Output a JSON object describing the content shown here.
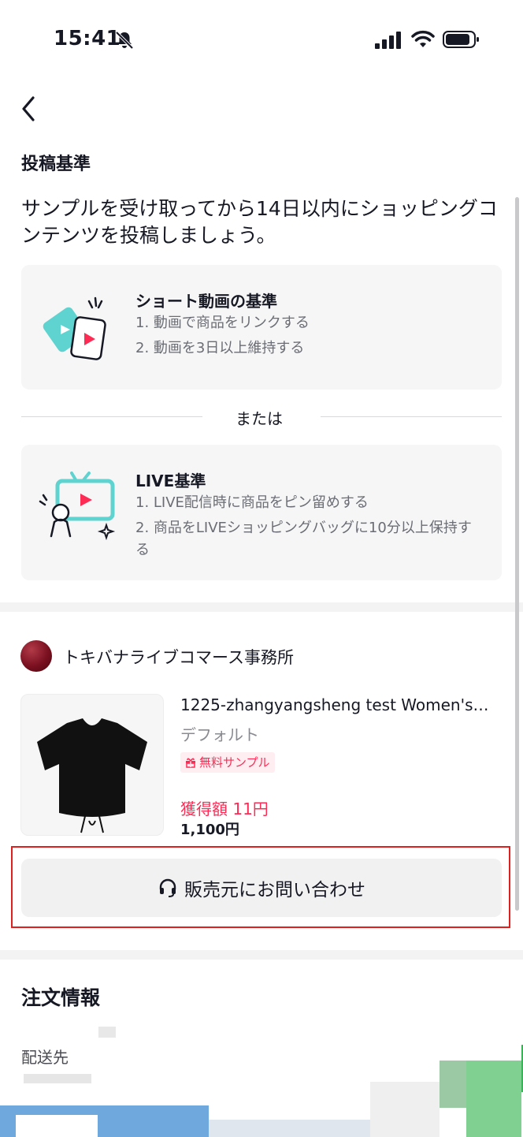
{
  "status_bar": {
    "time": "15:41"
  },
  "page": {
    "section_title": "投稿基準",
    "intro": "サンプルを受け取ってから14日以内にショッピングコンテンツを投稿しましょう。",
    "short_video": {
      "title": "ショート動画の基準",
      "items": [
        "1. 動画で商品をリンクする",
        "2. 動画を3日以上維持する"
      ]
    },
    "or_label": "または",
    "live": {
      "title": "LIVE基準",
      "items": [
        "1. LIVE配信時に商品をピン留めする",
        "2. 商品をLIVEショッピングバッグに10分以上保持する"
      ]
    }
  },
  "seller": {
    "name": "トキバナライブコマース事務所"
  },
  "product": {
    "title": "1225-zhangyangsheng test Women's…",
    "variant": "デフォルト",
    "badge": "無料サンプル",
    "earnings": "獲得額 11円",
    "price": "1,100円"
  },
  "contact_button": {
    "label": "販売元にお問い合わせ"
  },
  "order_info": {
    "title": "注文情報",
    "ship_label": "配送先"
  },
  "colors": {
    "accent": "#fe2c55",
    "teal": "#5fd3cf",
    "highlight": "#e0201f"
  }
}
